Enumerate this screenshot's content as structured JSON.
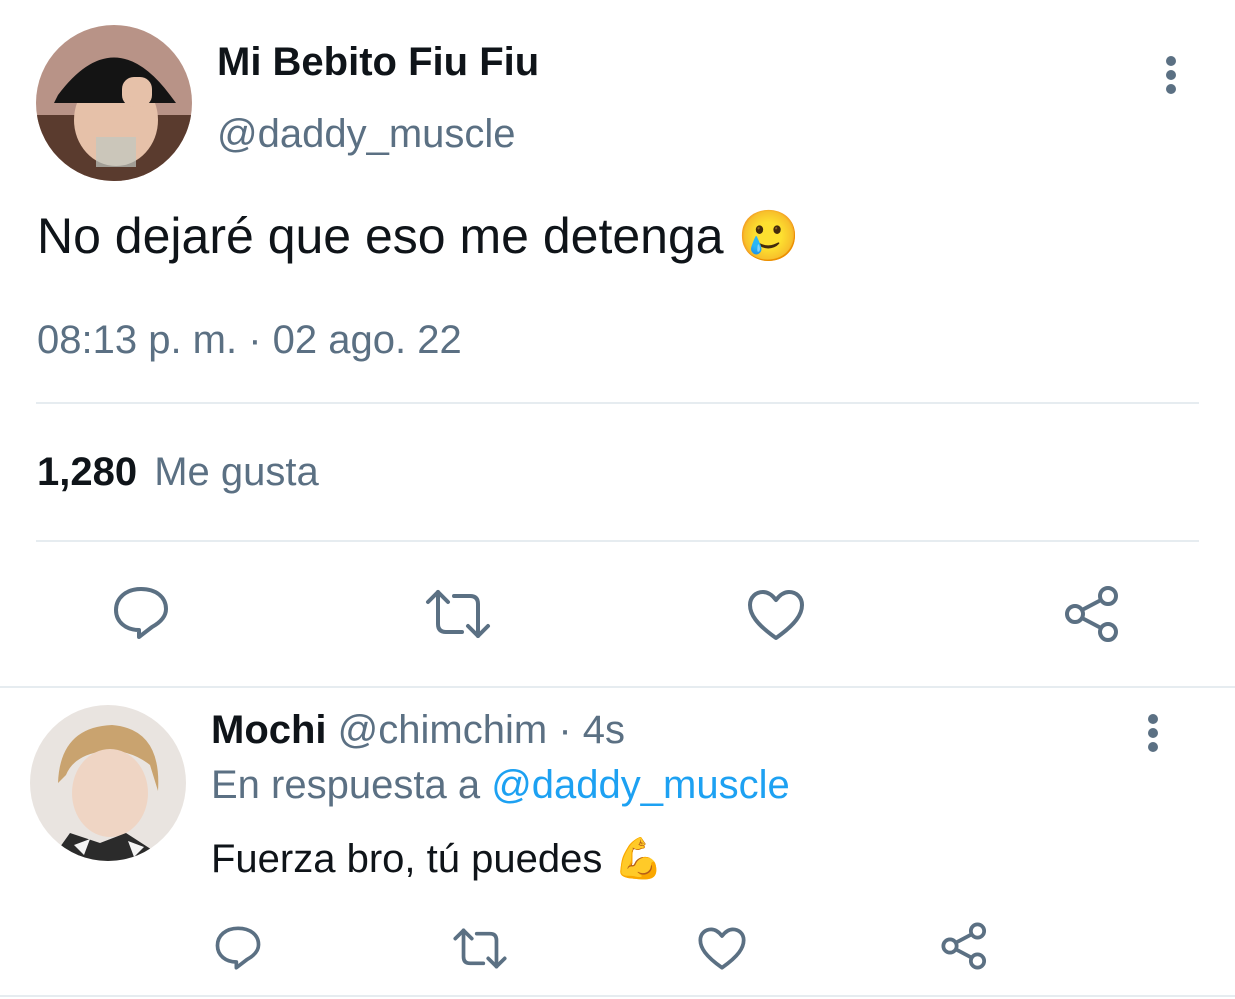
{
  "main_tweet": {
    "author_name": "Mi Bebito Fiu Fiu",
    "author_handle": "@daddy_muscle",
    "text": "No dejaré que eso me detenga",
    "emoji": "🥲",
    "timestamp": "08:13 p. m. · 02 ago. 22",
    "likes_count": "1,280",
    "likes_label": "Me gusta"
  },
  "reply_tweet": {
    "author_name": "Mochi",
    "author_handle": "@chimchim",
    "time_ago": "· 4s",
    "reply_prefix": "En respuesta a",
    "reply_to": "@daddy_muscle",
    "text": "Fuerza bro, tú puedes",
    "emoji": "💪"
  },
  "icons": [
    "more-vertical-icon",
    "reply-icon",
    "retweet-icon",
    "like-icon",
    "share-icon"
  ],
  "colors": {
    "muted": "#5b7083",
    "link": "#1da1f2",
    "divider": "#e6ecf0",
    "text": "#0f1419"
  }
}
